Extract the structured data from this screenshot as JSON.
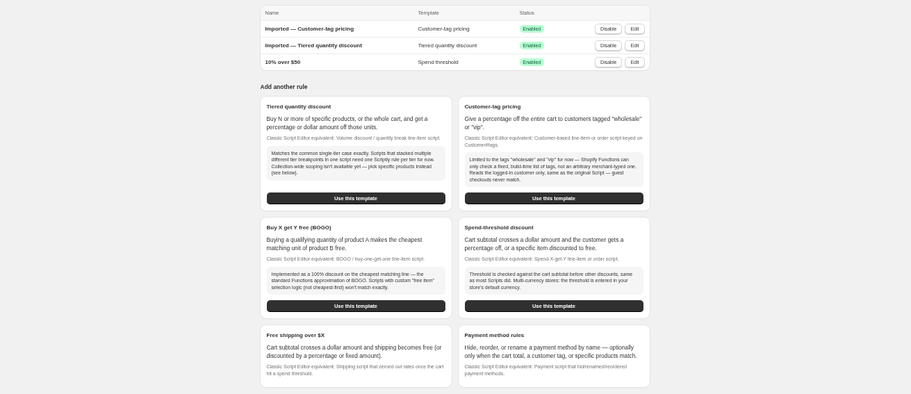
{
  "rules_table": {
    "columns": [
      "Name",
      "Template",
      "Status"
    ],
    "rows": [
      {
        "name": "Imported — Customer-tag pricing",
        "template": "Customer-tag pricing",
        "status": "Enabled",
        "actions": [
          "Disable",
          "Edit"
        ]
      },
      {
        "name": "Imported — Tiered quantity discount",
        "template": "Tiered quantity discount",
        "status": "Enabled",
        "actions": [
          "Disable",
          "Edit"
        ]
      },
      {
        "name": "10% over $50",
        "template": "Spend threshold",
        "status": "Enabled",
        "actions": [
          "Disable",
          "Edit"
        ]
      }
    ]
  },
  "add_section": {
    "heading": "Add another rule",
    "templates": [
      {
        "title": "Tiered quantity discount",
        "description": "Buy N or more of specific products, or the whole cart, and get a percentage or dollar amount off those units.",
        "equivalent": "Classic Script Editor equivalent: Volume discount / quantity break line-item script.",
        "note": "Matches the common single-tier case exactly. Scripts that stacked multiple different tier breakpoints in one script need one Scriptly rule per tier for now. Collection-wide scoping isn't available yet — pick specific products instead (see below).",
        "button": "Use this template"
      },
      {
        "title": "Customer-tag pricing",
        "description": "Give a percentage off the entire cart to customers tagged \"wholesale\" or \"vip\".",
        "equivalent": "Classic Script Editor equivalent: Customer-based line-item or order script keyed on Customer#tags.",
        "note": "Limited to the tags \"wholesale\" and \"vip\" for now — Shopify Functions can only check a fixed, build-time list of tags, not an arbitrary merchant-typed one. Reads the logged-in customer only, same as the original Script — guest checkouts never match.",
        "button": "Use this template"
      },
      {
        "title": "Buy X get Y free (BOGO)",
        "description": "Buying a qualifying quantity of product A makes the cheapest matching unit of product B free.",
        "equivalent": "Classic Script Editor equivalent: BOGO / buy-one-get-one line-item script.",
        "note": "Implemented as a 100% discount on the cheapest matching line — the standard Functions approximation of BOGO. Scripts with custom \"free item\" selection logic (not cheapest-first) won't match exactly.",
        "button": "Use this template"
      },
      {
        "title": "Spend-threshold discount",
        "description": "Cart subtotal crosses a dollar amount and the customer gets a percentage off, or a specific item discounted to free.",
        "equivalent": "Classic Script Editor equivalent: Spend-X-get-Y line-item or order script.",
        "note": "Threshold is checked against the cart subtotal before other discounts, same as most Scripts did. Multi-currency stores: the threshold is entered in your store's default currency.",
        "button": "Use this template"
      },
      {
        "title": "Free shipping over $X",
        "description": "Cart subtotal crosses a dollar amount and shipping becomes free (or discounted by a percentage or fixed amount).",
        "equivalent": "Classic Script Editor equivalent: Shipping script that zeroed out rates once the cart hit a spend threshold."
      },
      {
        "title": "Payment method rules",
        "description": "Hide, reorder, or rename a payment method by name — optionally only when the cart total, a customer tag, or specific products match.",
        "equivalent": "Classic Script Editor equivalent: Payment script that hid/renamed/reordered payment methods."
      }
    ]
  }
}
